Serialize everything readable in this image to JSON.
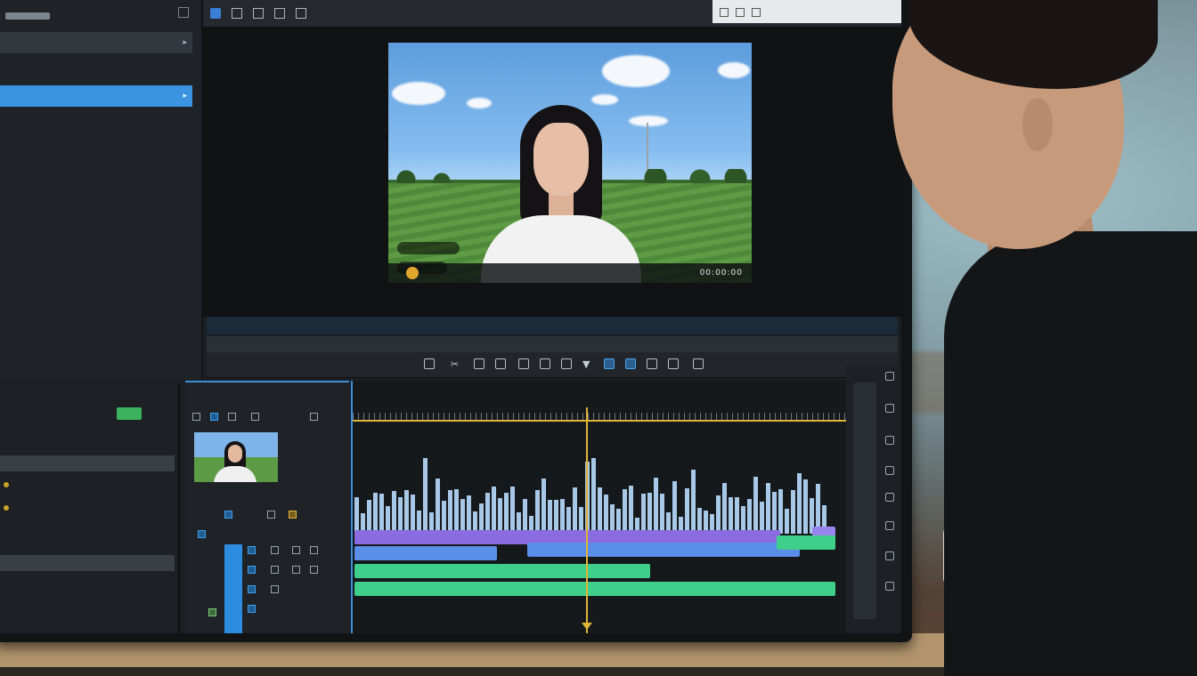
{
  "preview": {
    "timecode": "00:00:00"
  },
  "colors": {
    "accent_blue": "#3a94e0",
    "playhead": "#e0b43a",
    "clip_purple": "#8a6be0",
    "clip_blue": "#5a8ee8",
    "clip_green": "#3ecf8a"
  },
  "icons": [
    "folder-icon",
    "play-icon",
    "scissors-icon",
    "cursor-icon",
    "filter-icon",
    "settings-icon",
    "chevron-right-icon"
  ]
}
